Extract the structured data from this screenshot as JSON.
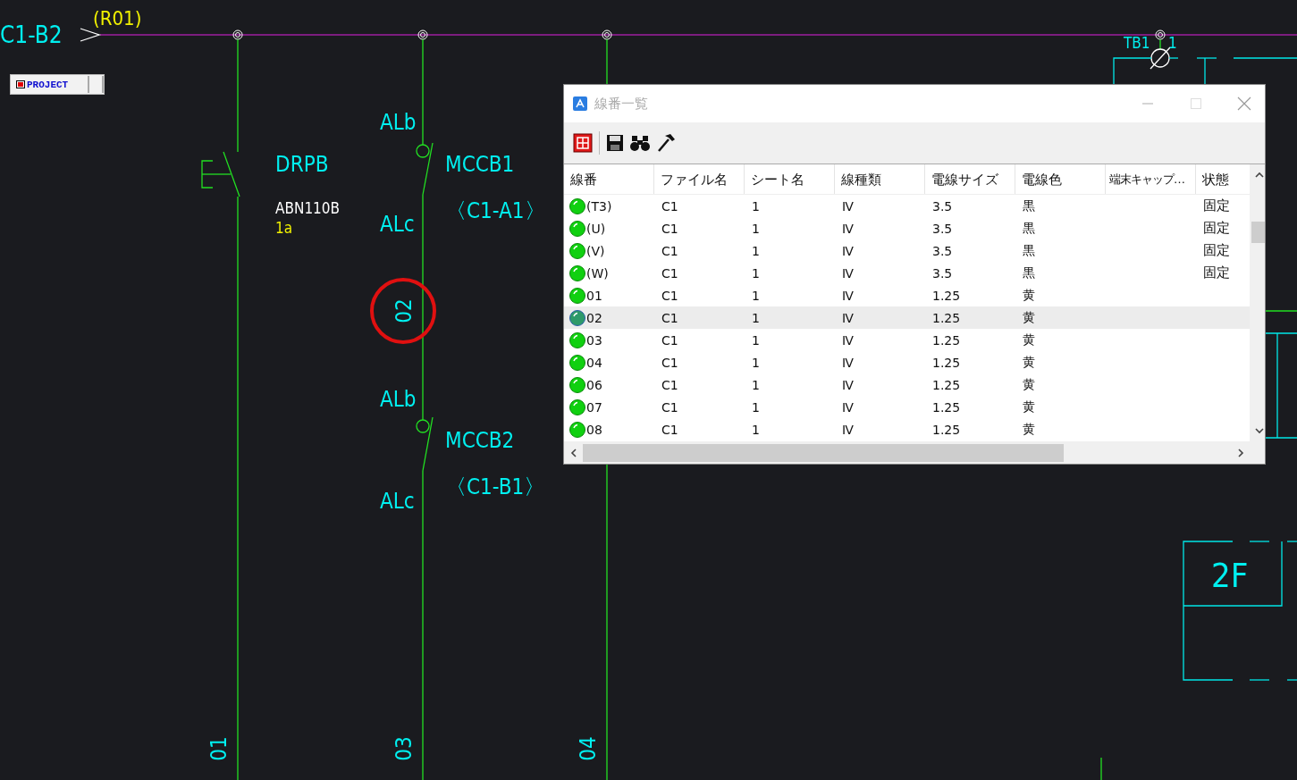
{
  "drawing": {
    "project_button": "PROJECT",
    "labels": [
      {
        "text": "C1-B2",
        "kind": "ref"
      },
      {
        "text": "(R01)",
        "kind": "note"
      },
      {
        "text": "DRPB",
        "kind": "ref"
      },
      {
        "text": "ABN110B",
        "kind": "spec"
      },
      {
        "text": "1a",
        "kind": "note"
      },
      {
        "text": "ALb",
        "kind": "ref"
      },
      {
        "text": "MCCB1",
        "kind": "ref"
      },
      {
        "text": "〈C1-A1〉",
        "kind": "ref"
      },
      {
        "text": "ALc",
        "kind": "ref"
      },
      {
        "text": "ALb",
        "kind": "ref"
      },
      {
        "text": "MCCB2",
        "kind": "ref"
      },
      {
        "text": "〈C1-B1〉",
        "kind": "ref"
      },
      {
        "text": "ALc",
        "kind": "ref"
      },
      {
        "text": "TB1",
        "kind": "ref"
      },
      {
        "text": "1",
        "kind": "ref"
      },
      {
        "text": "2F",
        "kind": "ref"
      }
    ],
    "wire_numbers": [
      {
        "text": "02",
        "highlighted": true
      },
      {
        "text": "01",
        "highlighted": false
      },
      {
        "text": "03",
        "highlighted": false
      },
      {
        "text": "04",
        "highlighted": false
      }
    ]
  },
  "dialog": {
    "title": "線番一覧",
    "columns": [
      "線番",
      "ファイル名",
      "シート名",
      "線種類",
      "電線サイズ",
      "電線色",
      "端末キャップ…",
      "状態"
    ],
    "rows": [
      {
        "wire": "(T3)",
        "file": "C1",
        "sheet": "1",
        "type": "Ⅳ",
        "size": "3.5",
        "wire_color": "黒",
        "state": "固定",
        "selected": false
      },
      {
        "wire": "(U)",
        "file": "C1",
        "sheet": "1",
        "type": "Ⅳ",
        "size": "3.5",
        "wire_color": "黒",
        "state": "固定",
        "selected": false
      },
      {
        "wire": "(V)",
        "file": "C1",
        "sheet": "1",
        "type": "Ⅳ",
        "size": "3.5",
        "wire_color": "黒",
        "state": "固定",
        "selected": false
      },
      {
        "wire": "(W)",
        "file": "C1",
        "sheet": "1",
        "type": "Ⅳ",
        "size": "3.5",
        "wire_color": "黒",
        "state": "固定",
        "selected": false
      },
      {
        "wire": "01",
        "file": "C1",
        "sheet": "1",
        "type": "Ⅳ",
        "size": "1.25",
        "wire_color": "黄",
        "selected": false
      },
      {
        "wire": "02",
        "file": "C1",
        "sheet": "1",
        "type": "Ⅳ",
        "size": "1.25",
        "wire_color": "黄",
        "selected": true
      },
      {
        "wire": "03",
        "file": "C1",
        "sheet": "1",
        "type": "Ⅳ",
        "size": "1.25",
        "wire_color": "黄",
        "selected": false
      },
      {
        "wire": "04",
        "file": "C1",
        "sheet": "1",
        "type": "Ⅳ",
        "size": "1.25",
        "wire_color": "黄",
        "selected": false
      },
      {
        "wire": "06",
        "file": "C1",
        "sheet": "1",
        "type": "Ⅳ",
        "size": "1.25",
        "wire_color": "黄",
        "selected": false
      },
      {
        "wire": "07",
        "file": "C1",
        "sheet": "1",
        "type": "Ⅳ",
        "size": "1.25",
        "wire_color": "黄",
        "selected": false
      },
      {
        "wire": "08",
        "file": "C1",
        "sheet": "1",
        "type": "Ⅳ",
        "size": "1.25",
        "wire_color": "黄",
        "selected": false
      }
    ]
  }
}
